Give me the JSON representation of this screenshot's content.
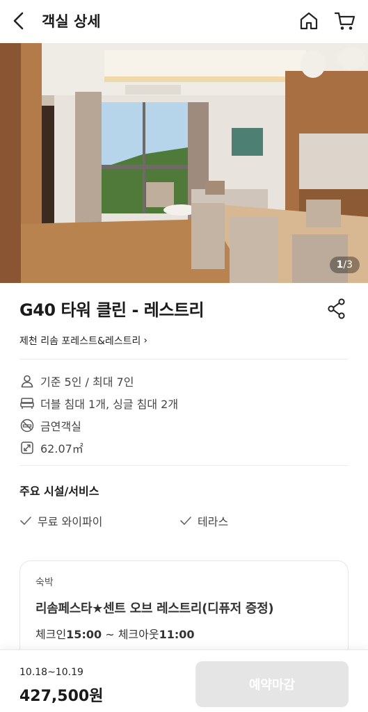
{
  "header": {
    "title": "객실 상세",
    "back_icon": "chevron-left-icon",
    "home_icon": "home-icon",
    "cart_icon": "cart-icon"
  },
  "gallery": {
    "current": "1",
    "separator": "/",
    "total": "3"
  },
  "room": {
    "title": "G40 타워 클린 - 레스트리",
    "hotel": "제천 리솜 포레스트&레스트리",
    "hotel_chevron": "›",
    "specs": [
      {
        "icon": "person-icon",
        "text": "기준 5인 / 최대 7인"
      },
      {
        "icon": "bed-icon",
        "text": "더블 침대 1개, 싱글 침대 2개"
      },
      {
        "icon": "no-smoking-icon",
        "text": "금연객실"
      },
      {
        "icon": "area-icon",
        "text": "62.07㎡"
      }
    ]
  },
  "facilities": {
    "title": "주요 시설/서비스",
    "items": [
      "무료 와이파이",
      "테라스"
    ]
  },
  "plan": {
    "type": "숙박",
    "name": "리솜페스타★센트 오브 레스트리(디퓨저 증정)",
    "checkin_label": "체크인",
    "checkin_time": "15:00",
    "tilde": "~",
    "checkout_label": "체크아웃",
    "checkout_time": "11:00"
  },
  "booking": {
    "dates": "10.18~10.19",
    "price": "427,500원",
    "button_label": "예약마감"
  },
  "colors": {
    "disabled_button": "#e5e5e5",
    "text_primary": "#1a1a1a"
  }
}
